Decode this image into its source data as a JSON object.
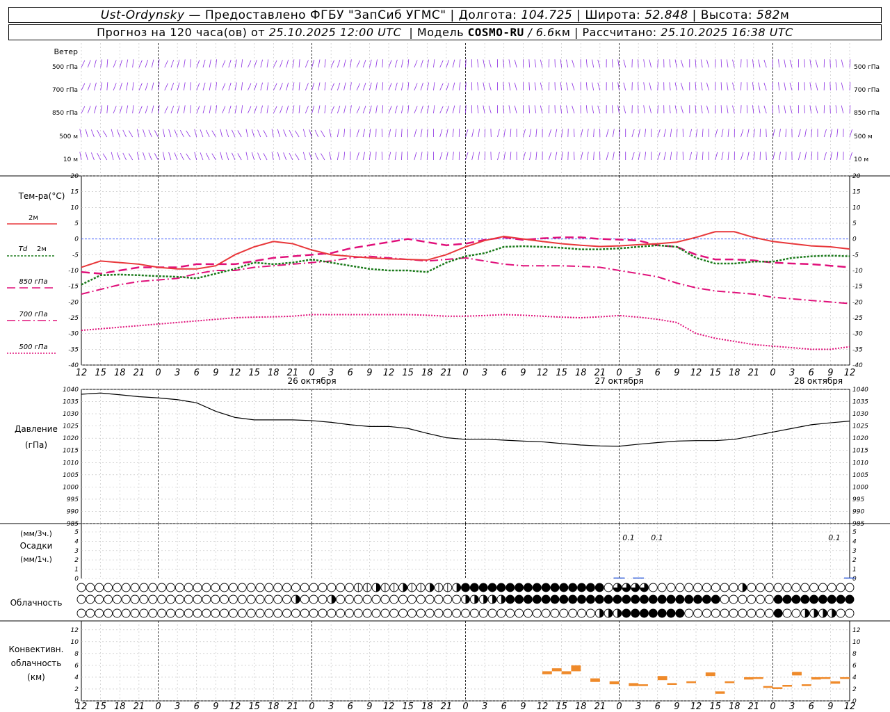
{
  "header": {
    "station": "Ust-Ordynsky",
    "provider": "— Предоставлено ФГБУ \"ЗапСиб УГМС\"",
    "lon_label": "Долгота:",
    "lon": "104.725",
    "lat_label": "Широта:",
    "lat": "52.848",
    "alt_label": "Высота:",
    "alt": "582",
    "alt_unit": "м",
    "forecast_prefix": "Прогноз на 120 часа(ов) от",
    "forecast_time": "25.10.2025 12:00 UTC",
    "model_label": "Модель",
    "model": "COSMO-RU",
    "model_res": "/ 6.6",
    "model_res_unit": "км",
    "calc_label": "Рассчитано:",
    "calc_time": "25.10.2025 16:38 UTC"
  },
  "labels": {
    "wind": "Ветер",
    "wind_levels": [
      "500 гПа",
      "700 гПа",
      "850 гПа",
      "500 м",
      "10  м"
    ],
    "temp_title": "Тем-ра(°C)",
    "leg_2m": "2м",
    "leg_td": "Td",
    "leg_td2": "2м",
    "leg_850": "850 гПа",
    "leg_700": "700 гПа",
    "leg_500": "500 гПа",
    "pressure": "Давление",
    "pressure_unit": "(гПа)",
    "precip_unit3": "(мм/3ч.)",
    "precip": "Осадки",
    "precip_unit1": "(мм/1ч.)",
    "cloud": "Облачность",
    "conv1": "Конвективн.",
    "conv2": "облачность",
    "conv3": "(км)",
    "day1": "26 октября",
    "day2": "27 октября",
    "day3": "28 октября",
    "precip_ann": [
      "0.1",
      "0.1",
      "0.1"
    ]
  },
  "colors": {
    "wind": "#8a2be2",
    "t2m": "#e8373a",
    "td2m": "#1a7a1a",
    "t850": "#e0107a",
    "t700": "#e0107a",
    "t500": "#e0107a",
    "pressure": "#000000",
    "conv": "#ef8a2a",
    "precip_blue": "#1f4fd8",
    "zero_line": "#3050ff"
  },
  "chart_data": [
    {
      "type": "line",
      "ylim": [
        -40,
        20
      ],
      "x_ticks": [
        "12",
        "15",
        "18",
        "21",
        "0",
        "3",
        "6",
        "9",
        "12",
        "15",
        "18",
        "21",
        "0",
        "3",
        "6",
        "9",
        "12",
        "15",
        "18",
        "21",
        "0",
        "3",
        "6",
        "9",
        "12",
        "15",
        "18"
      ],
      "series": [
        {
          "name": "2м",
          "x": [
            0,
            3,
            9,
            15,
            21,
            24,
            30,
            33,
            36,
            45,
            51,
            54,
            60,
            63,
            72,
            78,
            84,
            87,
            93,
            99,
            102,
            111,
            117,
            123,
            129,
            132,
            135,
            138,
            141,
            144,
            147,
            150,
            153,
            156,
            159,
            162,
            165,
            168,
            171,
            174,
            177,
            180,
            183,
            186,
            189,
            192,
            195,
            198,
            201,
            204,
            207,
            210,
            213,
            216,
            219,
            222,
            225,
            228,
            231,
            234,
            237,
            240,
            243,
            246,
            249,
            252,
            255,
            258
          ],
          "y": [
            -9.5,
            -8,
            -7,
            -7,
            -7.5,
            -9,
            -9,
            -9,
            -8.5,
            -6.5,
            -5.5,
            -5,
            -6,
            -7,
            -7,
            -6.5,
            -6,
            -5.5,
            -4,
            -3,
            -2.5,
            -2,
            -1.5,
            -1,
            -0.5,
            0,
            0.5,
            1,
            1.5,
            1,
            0.5,
            0,
            -0.5,
            -1,
            -1.5,
            -2,
            -2,
            -2,
            -2,
            -2,
            -2,
            -2,
            -2,
            -2,
            -2,
            -2,
            -2,
            -2,
            -2,
            -2,
            -2,
            -2,
            -2,
            -2,
            -2,
            -2,
            -2,
            -2,
            -2,
            -2,
            -2,
            -2,
            -2,
            -2,
            -2,
            -2,
            -2,
            -2
          ]
        },
        {
          "name": "Td 2м",
          "y_note": "see script"
        },
        {
          "name": "850 гПа"
        },
        {
          "name": "700 гПа"
        },
        {
          "name": "500 гПа"
        }
      ],
      "t2m": [
        -9,
        -7,
        -7.5,
        -8,
        -9,
        -9.5,
        -9.5,
        -8.5,
        -5,
        -2.5,
        -0.8,
        -1.5,
        -3.5,
        -5,
        -5.5,
        -6,
        -6.3,
        -6.5,
        -6.7,
        -5,
        -2.5,
        -0.5,
        0.8,
        0,
        -0.8,
        -1.5,
        -2,
        -2.4,
        -2.2,
        -1.8,
        -1.5,
        -1,
        0.5,
        2.3,
        2.3,
        0.5,
        -0.8,
        -1.5,
        -2.2,
        -2.5,
        -3.2
      ],
      "td2m": [
        -14.5,
        -11.5,
        -11.3,
        -11.5,
        -11.8,
        -12,
        -12.5,
        -11,
        -9.5,
        -7.5,
        -8,
        -7.5,
        -6.5,
        -7.5,
        -8.5,
        -9.5,
        -10,
        -10,
        -10.5,
        -7.5,
        -5.5,
        -4.5,
        -2.5,
        -2.3,
        -2.5,
        -2.8,
        -3.3,
        -3.3,
        -3,
        -2.5,
        -2,
        -2.5,
        -6,
        -7.8,
        -7.8,
        -7.2,
        -7.2,
        -6,
        -5.5,
        -5.3,
        -5.5
      ],
      "t850": [
        -10.5,
        -11,
        -10,
        -9,
        -9,
        -9,
        -8,
        -8,
        -8,
        -7,
        -6,
        -5.5,
        -5,
        -4.5,
        -3,
        -2,
        -1,
        0,
        -1,
        -2,
        -1.5,
        -0.3,
        0.5,
        -0.3,
        0.2,
        0.5,
        0.5,
        0,
        -0.2,
        -0.5,
        -2,
        -2.5,
        -5,
        -6.5,
        -6.5,
        -6.8,
        -7.5,
        -7.8,
        -8,
        -8.5,
        -9
      ],
      "t700": [
        -17.5,
        -16,
        -14.5,
        -13.5,
        -13,
        -12.5,
        -11,
        -10,
        -10,
        -9,
        -8.5,
        -8,
        -7.5,
        -7,
        -6,
        -5.5,
        -6,
        -6.5,
        -7,
        -6.5,
        -6,
        -7,
        -8,
        -8.5,
        -8.5,
        -8.5,
        -8.7,
        -9,
        -10,
        -11,
        -12,
        -14,
        -15.5,
        -16.5,
        -17,
        -17.5,
        -18.5,
        -19,
        -19.5,
        -20,
        -20.5
      ],
      "t500": [
        -29,
        -28.5,
        -28,
        -27.5,
        -27,
        -26.5,
        -26,
        -25.5,
        -25,
        -24.8,
        -24.7,
        -24.5,
        -24,
        -24,
        -24,
        -24,
        -24,
        -24,
        -24.2,
        -24.5,
        -24.5,
        -24.3,
        -24,
        -24.2,
        -24.5,
        -24.8,
        -25,
        -24.7,
        -24.3,
        -24.8,
        -25.5,
        -26.5,
        -30,
        -31.5,
        -32.5,
        -33.5,
        -34,
        -34.5,
        -35,
        -35,
        -34.2
      ]
    },
    {
      "type": "line",
      "name": "Давление",
      "ylim": [
        985,
        1040
      ],
      "values": [
        1038,
        1038.5,
        1037.8,
        1037,
        1036.5,
        1035.8,
        1034.5,
        1031,
        1028.5,
        1027.5,
        1027.5,
        1027.5,
        1027.2,
        1026.5,
        1025.5,
        1024.8,
        1024.8,
        1024,
        1022,
        1020.2,
        1019.5,
        1019.6,
        1019.2,
        1018.8,
        1018.5,
        1017.8,
        1017.2,
        1016.8,
        1016.7,
        1017.5,
        1018.2,
        1018.8,
        1019,
        1019,
        1019.5,
        1021,
        1022.5,
        1024,
        1025.5,
        1026.3,
        1027
      ]
    },
    {
      "type": "bar",
      "name": "Осадки",
      "ylim": [
        0,
        5
      ],
      "values": [
        0,
        0,
        0,
        0,
        0,
        0,
        0,
        0,
        0,
        0,
        0,
        0,
        0,
        0,
        0,
        0,
        0,
        0,
        0,
        0,
        0,
        0,
        0,
        0,
        0,
        0,
        0,
        0,
        0.1,
        0.1,
        0,
        0,
        0,
        0,
        0,
        0,
        0,
        0,
        0,
        0,
        0.1
      ]
    },
    {
      "type": "bar",
      "name": "Конвективн. облачность",
      "ylim": [
        0,
        12
      ],
      "ranges": [
        [
          24.5,
          4.5,
          5
        ],
        [
          25,
          5,
          5.5
        ],
        [
          25.5,
          4.5,
          5
        ],
        [
          26,
          5,
          6
        ],
        [
          27,
          3.2,
          3.8
        ],
        [
          28,
          2.8,
          3.3
        ],
        [
          29,
          2.5,
          3
        ],
        [
          29.5,
          2.5,
          2.8
        ],
        [
          30.5,
          3.5,
          4.2
        ],
        [
          31,
          2.7,
          3
        ],
        [
          32,
          3,
          3.3
        ],
        [
          33,
          4.2,
          4.8
        ],
        [
          33.5,
          1.2,
          1.6
        ],
        [
          34,
          3,
          3.3
        ],
        [
          35,
          3.6,
          4
        ],
        [
          35.5,
          3.7,
          4
        ],
        [
          36,
          2.2,
          2.5
        ],
        [
          36.5,
          2,
          2.3
        ],
        [
          37,
          2.4,
          2.7
        ],
        [
          37.5,
          4.3,
          4.9
        ],
        [
          38,
          2.5,
          2.8
        ],
        [
          38.5,
          3.6,
          4
        ],
        [
          39,
          3.7,
          4
        ],
        [
          39.5,
          2.9,
          3.3
        ],
        [
          40,
          3.7,
          4
        ]
      ]
    },
    {
      "type": "table",
      "name": "Облачность",
      "note": "three rows of cloud-cover symbols (low/mid/high), 0=clear, 8=overcast",
      "rows": [
        [
          0,
          0,
          0,
          0,
          0,
          0,
          0,
          0,
          0,
          0,
          0,
          0,
          0,
          0,
          0,
          0,
          0,
          0,
          0,
          0,
          0,
          0,
          0,
          0,
          0,
          0,
          0,
          0,
          4,
          0,
          0,
          0,
          0,
          0,
          0,
          0,
          0,
          0,
          0,
          0,
          0,
          0,
          0,
          0,
          0,
          0,
          0,
          0,
          0,
          0,
          0,
          0,
          0,
          0,
          0,
          0,
          0,
          0,
          0,
          0,
          4,
          0,
          0,
          0,
          0,
          0,
          0,
          0,
          0,
          0,
          0,
          0,
          0,
          0,
          0,
          0,
          0,
          0,
          0,
          0,
          0,
          0,
          0,
          0,
          0,
          0,
          0,
          0,
          0,
          0,
          0,
          0,
          0,
          0,
          0,
          0,
          0,
          0,
          0,
          0,
          0,
          0,
          0,
          0,
          0,
          0,
          0,
          0,
          0,
          0,
          0,
          0,
          0,
          0,
          0,
          0,
          0,
          0,
          0,
          0,
          0,
          0,
          0,
          0,
          0,
          0,
          0,
          0
        ],
        [
          0,
          0,
          0,
          0,
          0,
          0,
          0,
          0,
          0,
          0,
          0,
          0,
          0,
          0,
          0,
          0,
          0,
          0,
          0,
          0,
          0,
          0,
          0,
          0,
          0,
          0,
          0,
          0,
          0,
          0,
          0,
          0,
          0,
          0,
          0,
          0,
          0,
          0,
          0,
          0,
          0,
          0,
          0,
          0,
          0,
          0,
          0,
          0,
          0,
          0,
          0,
          0,
          0,
          0,
          0,
          0,
          0,
          0,
          0,
          0,
          0,
          0,
          0,
          0,
          0,
          0,
          0,
          0,
          0,
          0,
          0,
          0,
          0,
          0,
          0,
          0,
          0,
          0,
          0,
          0,
          0,
          0,
          0,
          0,
          0,
          0,
          0,
          0,
          0,
          0,
          0,
          0,
          0,
          0,
          0,
          0,
          0,
          0,
          0,
          0,
          0,
          0,
          0,
          0,
          0,
          0,
          0,
          0,
          0,
          0,
          0,
          0,
          0,
          0,
          0,
          0,
          0,
          0,
          0,
          0,
          0,
          0,
          0,
          0,
          0,
          0,
          0,
          0
        ],
        [
          0,
          0,
          0,
          0,
          0,
          0,
          0,
          0,
          0,
          0,
          0,
          0,
          0,
          0,
          0,
          0,
          0,
          0,
          0,
          0,
          0,
          0,
          0,
          0,
          0,
          0,
          0,
          0,
          0,
          0,
          0,
          0,
          0,
          0,
          0,
          0,
          0,
          0,
          0,
          0,
          0,
          0,
          0,
          0,
          0,
          0,
          0,
          0,
          0,
          0,
          0,
          0,
          0,
          0,
          0,
          0,
          0,
          0,
          0,
          0,
          0,
          0,
          0,
          0,
          0,
          0,
          0,
          0,
          0,
          0,
          0,
          0,
          0,
          0,
          0,
          0,
          0,
          0,
          0,
          0,
          0,
          0,
          0,
          0,
          0,
          0,
          0,
          0,
          0,
          0,
          0,
          0,
          0,
          0,
          0,
          0,
          0,
          0,
          0,
          0,
          0,
          0,
          0,
          0,
          0,
          0,
          0,
          0,
          0,
          0,
          0,
          0,
          0,
          0,
          0,
          0,
          0,
          0,
          0,
          0,
          0,
          0,
          0,
          0,
          0,
          0,
          0,
          0,
          0,
          0
        ]
      ]
    }
  ]
}
